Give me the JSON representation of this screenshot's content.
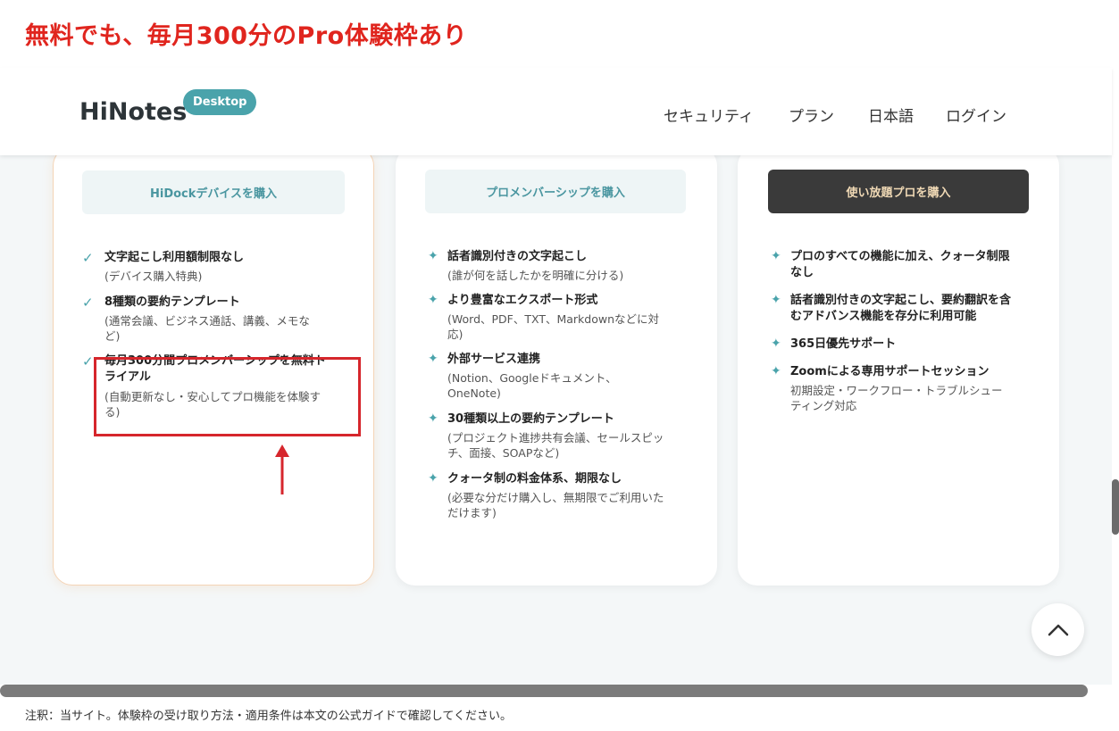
{
  "headline": "無料でも、毎月300分のPro体験枠あり",
  "header": {
    "logo": "HiNotes",
    "badge": "Desktop",
    "nav": [
      "セキュリティ",
      "プラン",
      "日本語",
      "ログイン"
    ]
  },
  "cards": [
    {
      "button": "HiDockデバイスを購入",
      "features": [
        {
          "title": "文字起こし利用額制限なし",
          "sub": "(デバイス購入特典)"
        },
        {
          "title": "8種類の要約テンプレート",
          "sub_lines": [
            "(通常会議、ビジネス通話、講義、メモな",
            "ど)"
          ]
        },
        {
          "title_lines": [
            "毎月300分間プロメンバーシップを無料ト",
            "ライアル"
          ],
          "sub_lines": [
            "(自動更新なし・安心してプロ機能を体験す",
            "る)"
          ]
        }
      ]
    },
    {
      "button": "プロメンバーシップを購入",
      "features": [
        {
          "title": "話者識別付きの文字起こし",
          "sub": "(誰が何を話したかを明確に分ける)"
        },
        {
          "title": "より豊富なエクスポート形式",
          "sub_lines": [
            "(Word、PDF、TXT、Markdownなどに対",
            "応)"
          ]
        },
        {
          "title": "外部サービス連携",
          "sub_lines": [
            "(Notion、Googleドキュメント、",
            "OneNote)"
          ]
        },
        {
          "title": "30種類以上の要約テンプレート",
          "sub_lines": [
            "(プロジェクト進捗共有会議、セールスピッ",
            "チ、面接、SOAPなど)"
          ]
        },
        {
          "title": "クォータ制の料金体系、期限なし",
          "sub_lines": [
            "(必要な分だけ購入し、無期限でご利用いた",
            "だけます)"
          ]
        }
      ]
    },
    {
      "button": "使い放題プロを購入",
      "features": [
        {
          "title_lines": [
            "プロのすべての機能に加え、クォータ制限",
            "なし"
          ]
        },
        {
          "title_lines": [
            "話者識別付きの文字起こし、要約翻訳を含",
            "むアドバンス機能を存分に利用可能"
          ]
        },
        {
          "title": "365日優先サポート"
        },
        {
          "title": "Zoomによる専用サポートセッション",
          "sub_lines": [
            "初期設定・ワークフロー・トラブルシュー",
            "ティング対応"
          ]
        }
      ]
    }
  ],
  "footnote": "注釈：当サイト。体験枠の受け取り方法・適用条件は本文の公式ガイドで確認してください。",
  "colors": {
    "headline": "#e0251e",
    "accent": "#4aa3ab",
    "highlight_box": "#d6262c"
  }
}
